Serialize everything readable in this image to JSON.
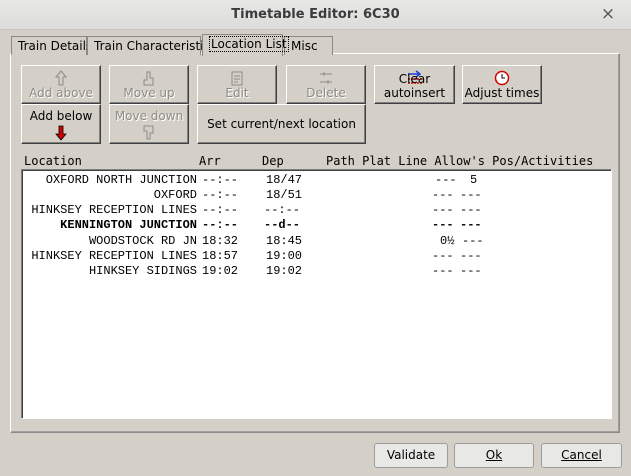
{
  "window": {
    "title": "Timetable Editor: 6C30",
    "close": "×"
  },
  "tabs": [
    {
      "label": "Train Details"
    },
    {
      "label": "Train Characteristics"
    },
    {
      "label": "Location List"
    },
    {
      "label": "Misc"
    }
  ],
  "buttons": {
    "add_above": "Add above",
    "move_up": "Move up",
    "edit": "Edit",
    "delete": "Delete",
    "clear_autoinsert": "Clear autoinsert",
    "adjust_times": "Adjust times",
    "add_below": "Add below",
    "move_down": "Move down",
    "set_current": "Set current/next location"
  },
  "columns": {
    "location": "Location",
    "arr": "Arr",
    "dep": "Dep",
    "rest": "Path Plat Line Allow's Pos/Activities"
  },
  "rows": [
    {
      "loc": "OXFORD NORTH JUNCTION",
      "arr": "--:--",
      "dep": "18/47",
      "allow": "---",
      "pos": "5",
      "bold": false
    },
    {
      "loc": "OXFORD",
      "arr": "--:--",
      "dep": "18/51",
      "allow": "---",
      "pos": "---",
      "bold": false
    },
    {
      "loc": "HINKSEY RECEPTION LINES",
      "arr": "--:--",
      "dep": "--:--",
      "allow": "---",
      "pos": "---",
      "bold": false
    },
    {
      "loc": "KENNINGTON JUNCTION",
      "arr": "--:--",
      "dep": "--d--",
      "allow": "---",
      "pos": "---",
      "bold": true
    },
    {
      "loc": "WOODSTOCK RD JN",
      "arr": "18:32",
      "dep": "18:45",
      "allow": "0½",
      "pos": "---",
      "bold": false
    },
    {
      "loc": "HINKSEY RECEPTION LINES",
      "arr": "18:57",
      "dep": "19:00",
      "allow": "---",
      "pos": "---",
      "bold": false
    },
    {
      "loc": "HINKSEY SIDINGS",
      "arr": "19:02",
      "dep": "19:02",
      "allow": "---",
      "pos": "---",
      "bold": false
    }
  ],
  "footer": {
    "validate": "Validate",
    "ok": "Ok",
    "cancel": "Cancel"
  },
  "colors": {
    "accent_red": "#d00000",
    "accent_blue": "#1a3fcf"
  }
}
